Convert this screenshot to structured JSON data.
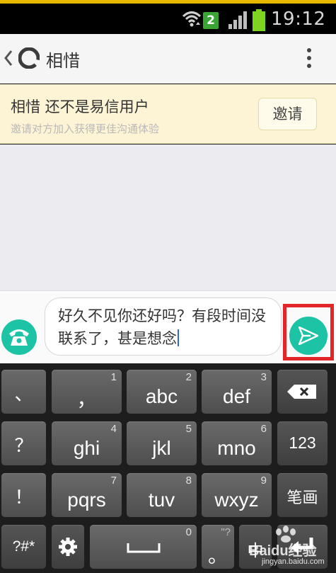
{
  "status_bar": {
    "notification_count": "2",
    "time": "19:12",
    "battery_color": "#7fd321"
  },
  "header": {
    "title": "相惜"
  },
  "banner": {
    "title": "相惜 还不是易信用户",
    "subtitle": "邀请对方加入获得更佳沟通体验",
    "invite_label": "邀请"
  },
  "composer": {
    "message": "好久不见你还好吗？有段时间没联系了，甚是想念",
    "accent_color": "#1cc3a4",
    "highlight_color": "#e3262a"
  },
  "keyboard": {
    "rows": [
      [
        {
          "main": "、",
          "num": ""
        },
        {
          "main": "，",
          "num": "1"
        },
        {
          "main": "abc",
          "num": "2"
        },
        {
          "main": "def",
          "num": "3"
        },
        {
          "main": "backspace-icon",
          "num": ""
        }
      ],
      [
        {
          "main": "？",
          "num": ""
        },
        {
          "main": "ghi",
          "num": "4"
        },
        {
          "main": "jkl",
          "num": "5"
        },
        {
          "main": "mno",
          "num": "6"
        },
        {
          "main": "123",
          "num": ""
        }
      ],
      [
        {
          "main": "！",
          "num": ""
        },
        {
          "main": "pqrs",
          "num": "7"
        },
        {
          "main": "tuv",
          "num": "8"
        },
        {
          "main": "wxyz",
          "num": "9"
        },
        {
          "main": "笔画",
          "num": ""
        }
      ],
      [
        {
          "main": "?#*",
          "num": ""
        },
        {
          "main": "gear-icon",
          "num": ""
        },
        {
          "main": "space-icon",
          "num": "0"
        },
        {
          "main": "。",
          "num": "\"?"
        },
        {
          "main": "中",
          "num": ""
        },
        {
          "main": "enter-icon",
          "num": ""
        }
      ]
    ]
  },
  "watermark": {
    "brand": "Baidu经验",
    "url": "jingyan.baidu.com"
  }
}
